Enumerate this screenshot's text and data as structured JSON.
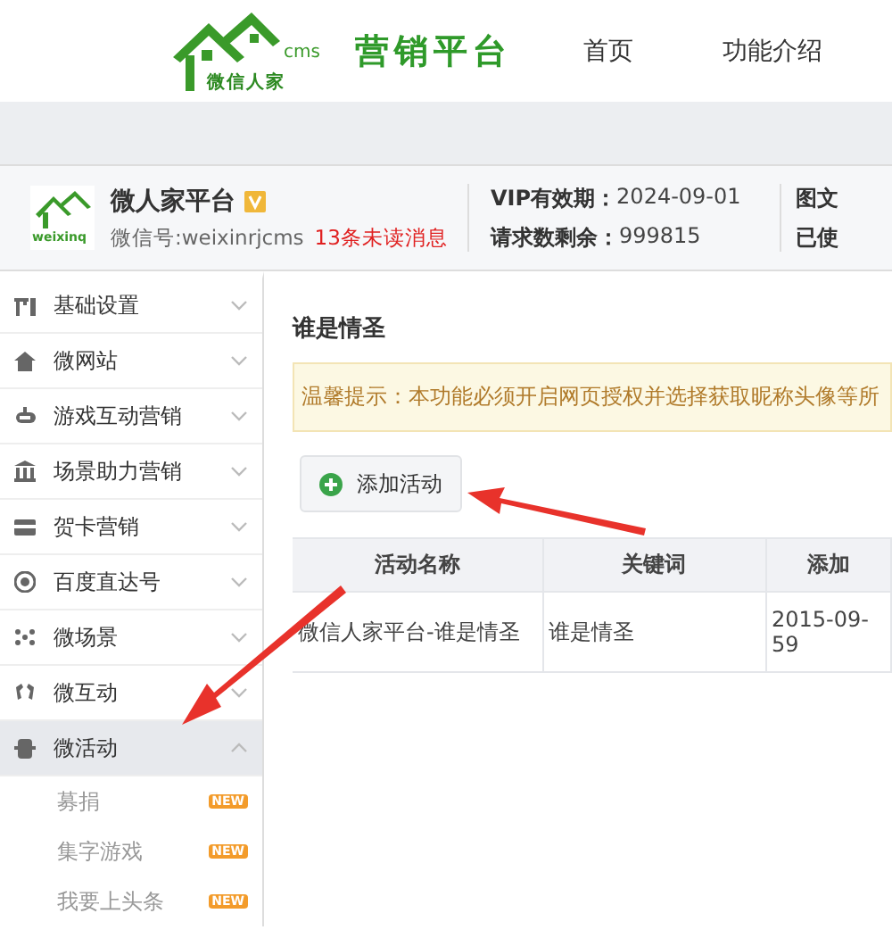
{
  "header": {
    "logo": {
      "mark": "cms",
      "name": "微信人家"
    },
    "title": "营销平台",
    "nav": [
      {
        "label": "首页"
      },
      {
        "label": "功能介绍"
      }
    ]
  },
  "account": {
    "avatar_text": "weixinq",
    "name": "微人家平台",
    "wechat_id": "微信号:weixinrjcms",
    "unread": "13条未读消息",
    "stats": [
      {
        "label": "VIP有效期：",
        "value": "2024-09-01"
      },
      {
        "label": "请求数剩余：",
        "value": "999815"
      }
    ],
    "stats_2": [
      "图文",
      "已使"
    ]
  },
  "sidebar": {
    "items": [
      {
        "label": "基础设置",
        "expanded": false
      },
      {
        "label": "微网站",
        "expanded": false
      },
      {
        "label": "游戏互动营销",
        "expanded": false
      },
      {
        "label": "场景助力营销",
        "expanded": false
      },
      {
        "label": "贺卡营销",
        "expanded": false
      },
      {
        "label": "百度直达号",
        "expanded": false
      },
      {
        "label": "微场景",
        "expanded": false
      },
      {
        "label": "微互动",
        "expanded": false
      },
      {
        "label": "微活动",
        "expanded": true,
        "children": [
          {
            "label": "募捐",
            "badge": "NEW"
          },
          {
            "label": "集字游戏",
            "badge": "NEW"
          },
          {
            "label": "我要上头条",
            "badge": "NEW"
          }
        ]
      }
    ]
  },
  "main": {
    "title": "谁是情圣",
    "notice": "温馨提示：本功能必须开启网页授权并选择获取昵称头像等所",
    "add_button": "添加活动",
    "table": {
      "columns": [
        "活动名称",
        "关键词",
        "添加"
      ],
      "rows": [
        [
          "微信人家平台-谁是情圣",
          "谁是情圣",
          "2015-09-\n59"
        ]
      ]
    }
  }
}
